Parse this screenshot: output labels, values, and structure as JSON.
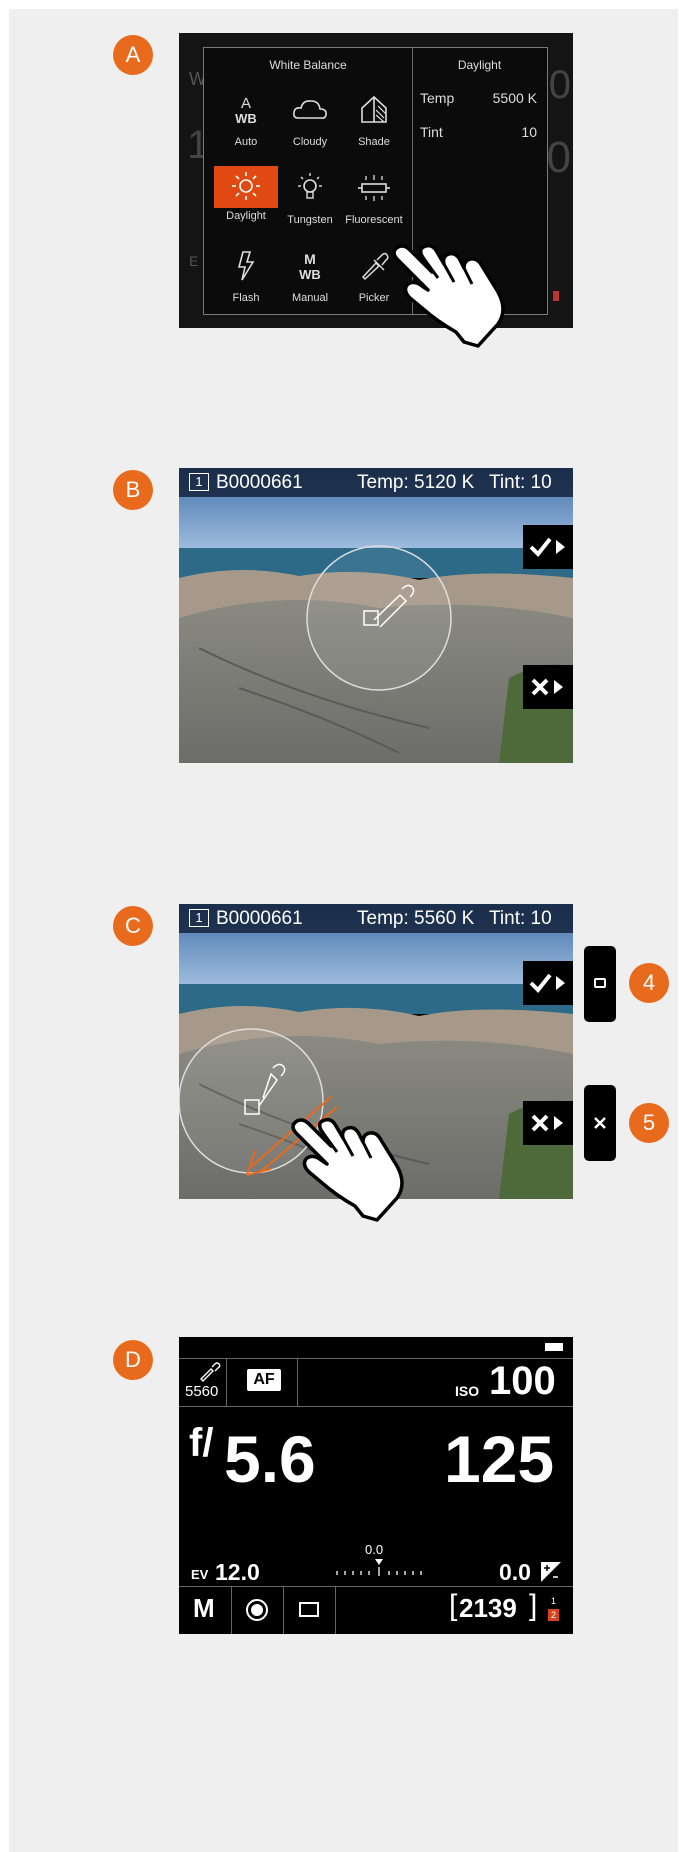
{
  "markers": {
    "a": "A",
    "b": "B",
    "c": "C",
    "d": "D",
    "four": "4",
    "five": "5"
  },
  "colors": {
    "accent": "#e86a1c",
    "selected": "#e04a12",
    "panel": "#efefef"
  },
  "screen_a": {
    "menu_title": "White Balance",
    "items": [
      {
        "icon": "auto-wb-icon",
        "label": "Auto"
      },
      {
        "icon": "cloudy-icon",
        "label": "Cloudy"
      },
      {
        "icon": "shade-icon",
        "label": "Shade"
      },
      {
        "icon": "daylight-icon",
        "label": "Daylight",
        "selected": true
      },
      {
        "icon": "tungsten-icon",
        "label": "Tungsten"
      },
      {
        "icon": "fluorescent-icon",
        "label": "Fluorescent"
      },
      {
        "icon": "flash-icon",
        "label": "Flash"
      },
      {
        "icon": "manual-wb-icon",
        "label": "Manual"
      },
      {
        "icon": "picker-icon",
        "label": "Picker"
      }
    ],
    "detail_title": "Daylight",
    "temp_label": "Temp",
    "temp_value": "5500 K",
    "tint_label": "Tint",
    "tint_value": "10"
  },
  "screen_b": {
    "slot": "1",
    "filename": "B0000661",
    "temp": "Temp: 5120 K",
    "tint": "Tint: 10"
  },
  "screen_c": {
    "slot": "1",
    "filename": "B0000661",
    "temp": "Temp: 5560 K",
    "tint": "Tint: 10"
  },
  "screen_d": {
    "picker_value": "5560",
    "af": "AF",
    "iso_label": "ISO",
    "iso_value": "100",
    "aperture_prefix": "f/",
    "aperture_value": "5.6",
    "shutter_value": "125",
    "ev_label": "EV",
    "ev_value": "12.0",
    "exposure_comp_scale": "0.0",
    "exposure_comp_value": "0.0",
    "mode": "M",
    "shots_remaining": "2139",
    "card_slot_1": "1",
    "card_slot_2": "2"
  }
}
